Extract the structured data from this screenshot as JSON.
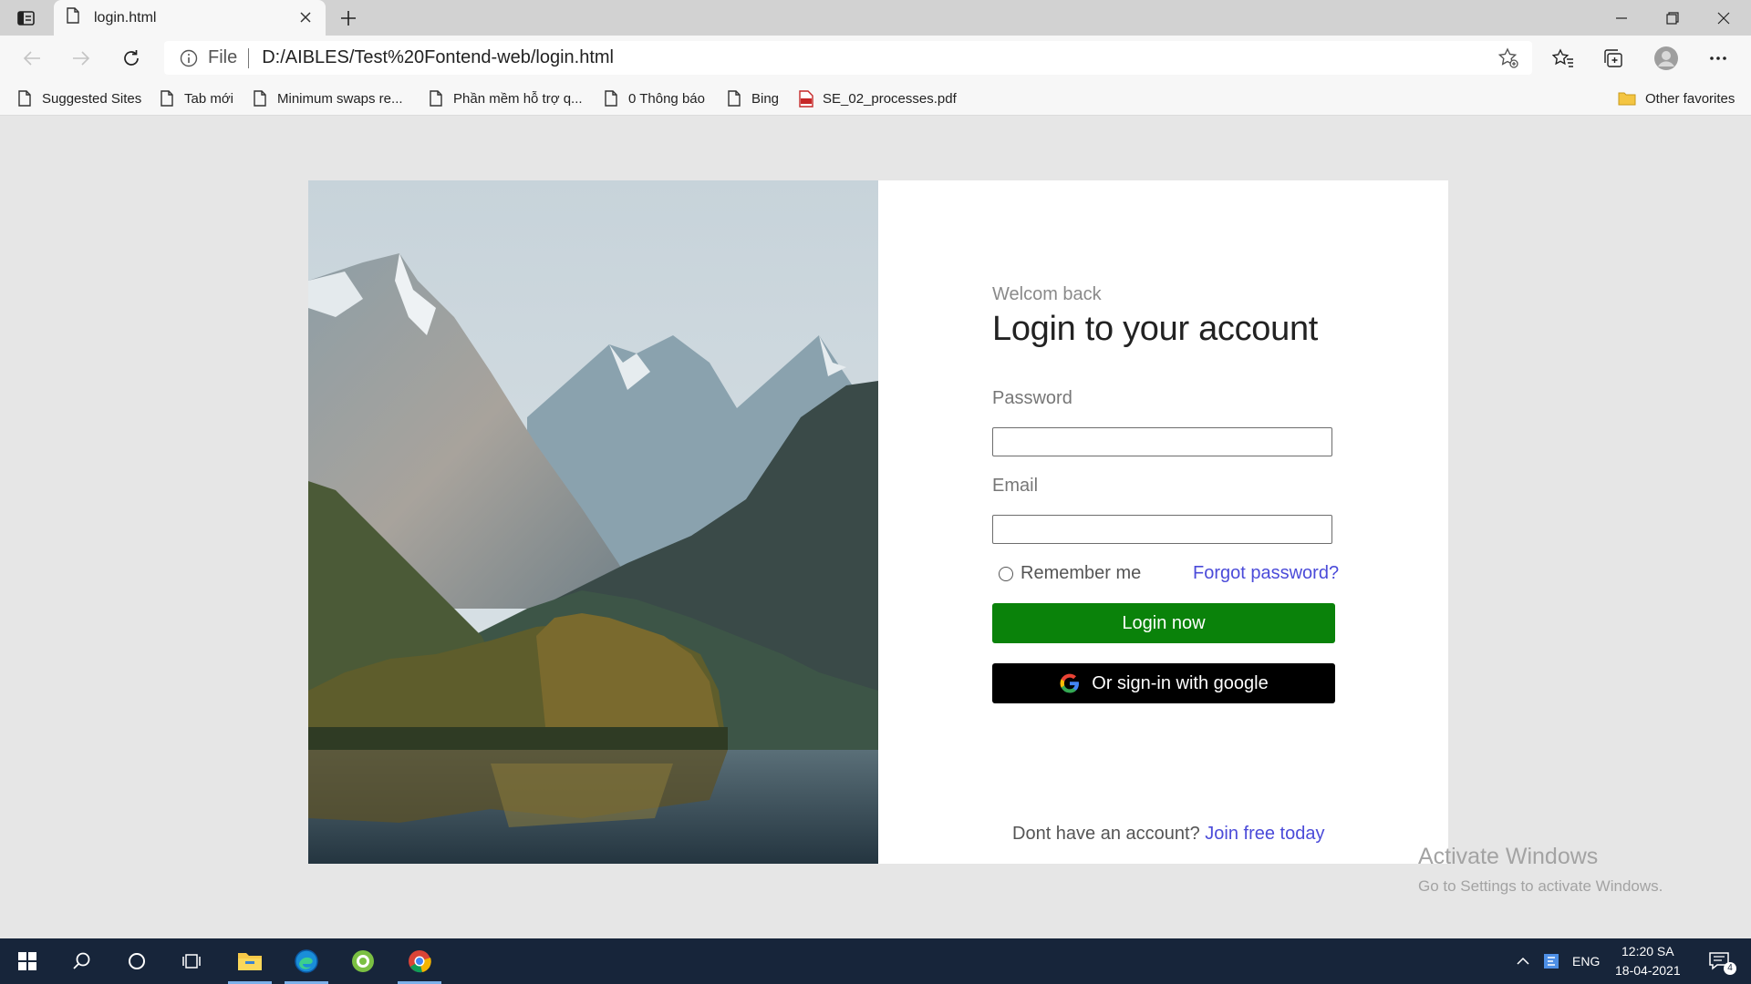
{
  "browser": {
    "tab_title": "login.html",
    "address_scheme": "File",
    "address_url": "D:/AIBLES/Test%20Fontend-web/login.html",
    "bookmarks": [
      {
        "label": "Suggested Sites",
        "icon": "page-icon"
      },
      {
        "label": "Tab mới",
        "icon": "page-icon"
      },
      {
        "label": "Minimum swaps re...",
        "icon": "page-icon"
      },
      {
        "label": "Phần mềm hỗ trợ q...",
        "icon": "page-icon"
      },
      {
        "label": "0 Thông báo",
        "icon": "page-icon"
      },
      {
        "label": "Bing",
        "icon": "page-icon"
      },
      {
        "label": "SE_02_processes.pdf",
        "icon": "pdf-icon"
      }
    ],
    "other_favorites": "Other favorites"
  },
  "login": {
    "welcome": "Welcom back",
    "heading": "Login to your account",
    "password_label": "Password",
    "email_label": "Email",
    "remember_label": "Remember me",
    "forgot_label": "Forgot password?",
    "login_button": "Login now",
    "google_button": "Or sign-in with google",
    "no_account": "Dont have an account?",
    "join_link": "Join free today"
  },
  "watermark": {
    "title": "Activate Windows",
    "subtitle": "Go to Settings to activate Windows."
  },
  "taskbar": {
    "language": "ENG",
    "time": "12:20 SA",
    "date": "18-04-2021",
    "notification_count": "4"
  },
  "colors": {
    "login_button": "#0a820a",
    "google_button": "#000000",
    "link": "#4b4bd9",
    "taskbar": "#17253a"
  }
}
